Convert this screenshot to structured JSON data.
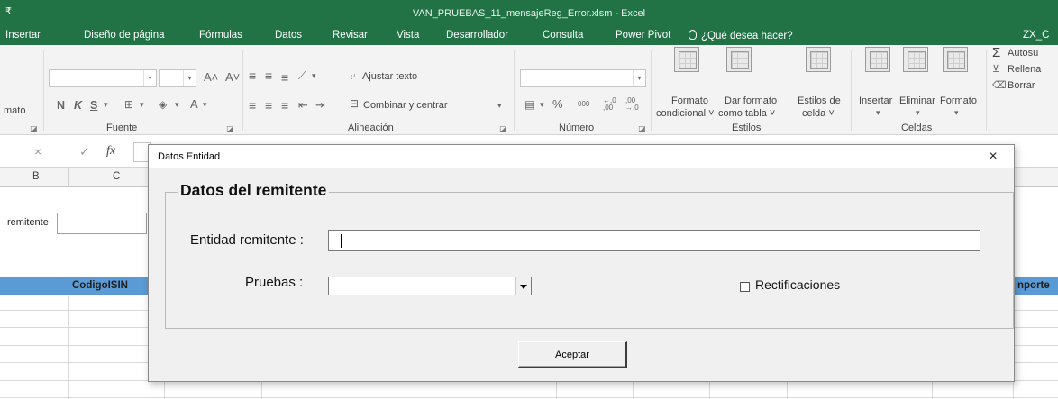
{
  "window": {
    "title": "VAN_PRUEBAS_11_mensajeReg_Error.xlsm - Excel",
    "quick_access_glyph": "₹"
  },
  "colors": {
    "excel_green": "#217346",
    "table_header_blue": "#5b9bd5",
    "dialog_bg": "#f0f0f0"
  },
  "ribbon_tabs": [
    "Insertar",
    "Diseño de página",
    "Fórmulas",
    "Datos",
    "Revisar",
    "Vista",
    "Desarrollador",
    "Consulta",
    "Power Pivot",
    "¿Qué desea hacer?",
    "ZX_C"
  ],
  "ribbon": {
    "clipboard": {
      "partial_label": "mato"
    },
    "font": {
      "group": "Fuente",
      "bold": "N",
      "italic": "K",
      "underline": "S",
      "grow": "A˄",
      "shrink": "A˅",
      "color_a": "A"
    },
    "alignment": {
      "group": "Alineación",
      "wrap": "Ajustar texto",
      "merge": "Combinar y centrar"
    },
    "number": {
      "group": "Número",
      "percent": "%",
      "thousands": "000",
      "inc_dec": "←,0 ,00",
      "dec_dec": ",00 →,0"
    },
    "styles": {
      "group": "Estilos",
      "conditional": [
        "Formato",
        "condicional ˅"
      ],
      "as_table": [
        "Dar formato",
        "como tabla ˅"
      ],
      "cell_styles": [
        "Estilos de",
        "celda ˅"
      ]
    },
    "cells": {
      "group": "Celdas",
      "insert": "Insertar",
      "delete": "Eliminar",
      "format": "Formato"
    },
    "editing": {
      "autosum": "Autosu",
      "fill": "Rellena",
      "clear": "Borrar"
    }
  },
  "formula_bar": {
    "cancel": "×",
    "enter": "✓",
    "fx": "fx"
  },
  "sheet": {
    "columns": [
      "B",
      "C"
    ],
    "label": "remitente",
    "headers": {
      "codigo": "CodigoISIN",
      "importe": "nporte"
    }
  },
  "dialog": {
    "title": "Datos Entidad",
    "close": "×",
    "frame_title": "Datos del remitente",
    "entidad_label": "Entidad remitente :",
    "entidad_value": "",
    "pruebas_label": "Pruebas :",
    "pruebas_selected": "",
    "rectificaciones_label": "Rectificaciones",
    "rectificaciones_checked": false,
    "accept_label": "Aceptar"
  }
}
